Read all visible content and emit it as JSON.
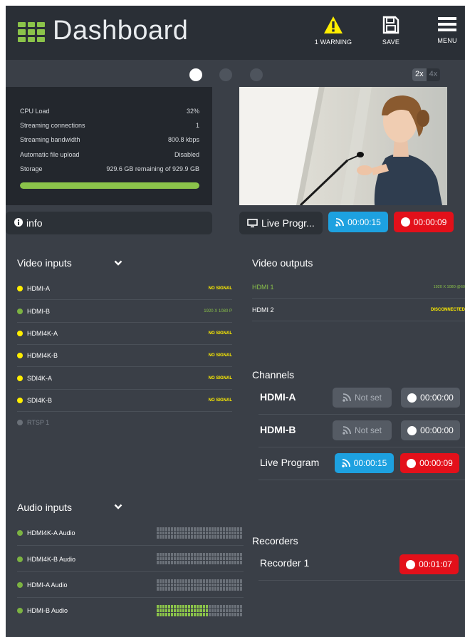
{
  "header": {
    "title": "Dashboard",
    "warning_label": "1 WARNING",
    "save_label": "SAVE",
    "menu_label": "MENU",
    "icons": [
      "grid-logo-icon",
      "warning-icon",
      "floppy-disk-icon",
      "hamburger-menu-icon"
    ]
  },
  "colors": {
    "accent_green": "#8bc34a",
    "stream_blue": "#1da1e0",
    "record_red": "#e3101a",
    "warning_yellow": "#ffee00",
    "panel_dark": "#23272d",
    "background": "#3a3f47"
  },
  "zoom": {
    "options": [
      "2x",
      "4x"
    ],
    "selected": "2x"
  },
  "pager": {
    "pages": 3,
    "active": 1
  },
  "stats": {
    "rows": [
      {
        "label": "CPU Load",
        "value": "32%"
      },
      {
        "label": "Streaming connections",
        "value": "1"
      },
      {
        "label": "Streaming bandwidth",
        "value": "800.8 kbps"
      },
      {
        "label": "Automatic file upload",
        "value": "Disabled"
      },
      {
        "label": "Storage",
        "value": "929.6 GB remaining of 929.9 GB"
      }
    ],
    "storage_used_fraction": 1.0
  },
  "info_button": {
    "label": "info"
  },
  "live_program": {
    "label": "Live Progr...",
    "stream_time": "00:00:15",
    "record_time": "00:00:09"
  },
  "video_inputs": {
    "title": "Video inputs",
    "items": [
      {
        "name": "HDMI-A",
        "status": "NO SIGNAL",
        "state": "yellow"
      },
      {
        "name": "HDMI-B",
        "status": "1920 X 1080 P",
        "state": "green"
      },
      {
        "name": "HDMI4K-A",
        "status": "NO SIGNAL",
        "state": "yellow"
      },
      {
        "name": "HDMI4K-B",
        "status": "NO SIGNAL",
        "state": "yellow"
      },
      {
        "name": "SDI4K-A",
        "status": "NO SIGNAL",
        "state": "yellow"
      },
      {
        "name": "SDI4K-B",
        "status": "NO SIGNAL",
        "state": "yellow"
      },
      {
        "name": "RTSP 1",
        "status": "",
        "state": "gray"
      }
    ]
  },
  "video_outputs": {
    "title": "Video outputs",
    "items": [
      {
        "name": "HDMI 1",
        "status": "1920 X 1080 @60"
      },
      {
        "name": "HDMI 2",
        "status": "DISCONNECTED"
      }
    ]
  },
  "channels": {
    "title": "Channels",
    "items": [
      {
        "name": "HDMI-A",
        "stream": "Not set",
        "record": "00:00:00"
      },
      {
        "name": "HDMI-B",
        "stream": "Not set",
        "record": "00:00:00"
      },
      {
        "name": "Live Program",
        "stream": "00:00:15",
        "record": "00:00:09"
      }
    ]
  },
  "audio_inputs": {
    "title": "Audio inputs",
    "items": [
      {
        "name": "HDMI4K-A Audio",
        "level_fraction": 0.0
      },
      {
        "name": "HDMI4K-B Audio",
        "level_fraction": 0.0
      },
      {
        "name": "HDMI-A Audio",
        "level_fraction": 0.0
      },
      {
        "name": "HDMI-B Audio",
        "level_fraction": 0.6
      }
    ]
  },
  "recorders": {
    "title": "Recorders",
    "items": [
      {
        "name": "Recorder 1",
        "record": "00:01:07"
      }
    ]
  }
}
